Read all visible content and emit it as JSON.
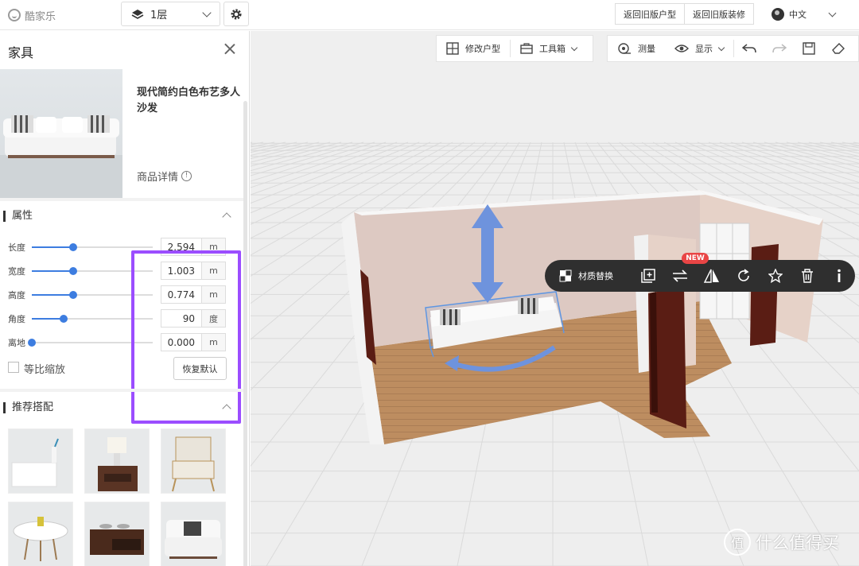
{
  "app": {
    "brand": "酷家乐"
  },
  "topbar": {
    "floor": "1层",
    "btn_old_layout": "返回旧版户型",
    "btn_old_decor": "返回旧版装修",
    "language": "中文"
  },
  "panel": {
    "title": "家具",
    "product_name": "现代简约白色布艺多人沙发",
    "product_detail": "商品详情",
    "section_props": "属性",
    "props": [
      {
        "label": "长度",
        "value": "2.594",
        "unit": "m",
        "slider": 0.34
      },
      {
        "label": "宽度",
        "value": "1.003",
        "unit": "m",
        "slider": 0.34
      },
      {
        "label": "高度",
        "value": "0.774",
        "unit": "m",
        "slider": 0.34
      },
      {
        "label": "角度",
        "value": "90",
        "unit": "度",
        "slider": 0.26
      },
      {
        "label": "离地",
        "value": "0.000",
        "unit": "m",
        "slider": 0.0
      }
    ],
    "proportional_scale": "等比缩放",
    "reset": "恢复默认",
    "section_rec": "推荐搭配"
  },
  "view_toolbar": {
    "edit_layout": "修改户型",
    "toolbox": "工具箱",
    "measure": "测量",
    "display": "显示"
  },
  "context_toolbar": {
    "material_replace": "材质替换",
    "new_badge": "NEW"
  },
  "watermark": {
    "logo": "值",
    "text": "什么值得买"
  }
}
